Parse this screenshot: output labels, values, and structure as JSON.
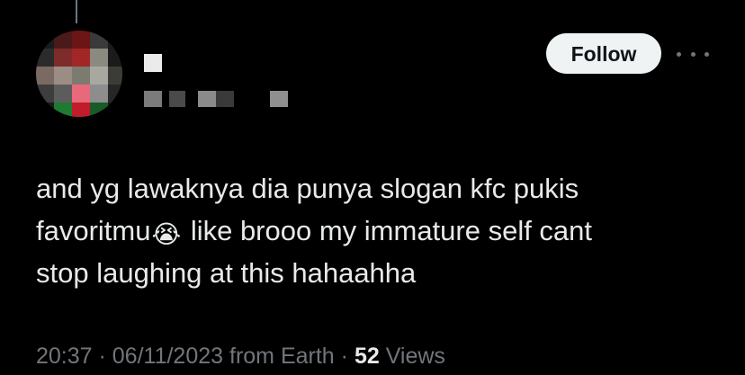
{
  "tweet": {
    "follow_label": "Follow",
    "text_part1": "and yg lawaknya dia punya slogan kfc pukis\nfavoritmu",
    "emoji": "😭",
    "text_part2": " like brooo my immature self cant\nstop laughing at this hahaahha",
    "time": "20:37",
    "separator": " · ",
    "date": "06/11/2023",
    "source": " from Earth",
    "views_count": "52",
    "views_label": " Views"
  },
  "icons": {
    "more": "more-horizontal-icon",
    "emoji": "loudly-crying-face-emoji"
  },
  "colors": {
    "background": "#000000",
    "text": "#e7e9ea",
    "secondary_text": "#71767b",
    "follow_button_bg": "#eff3f4",
    "follow_button_text": "#0f1419"
  }
}
